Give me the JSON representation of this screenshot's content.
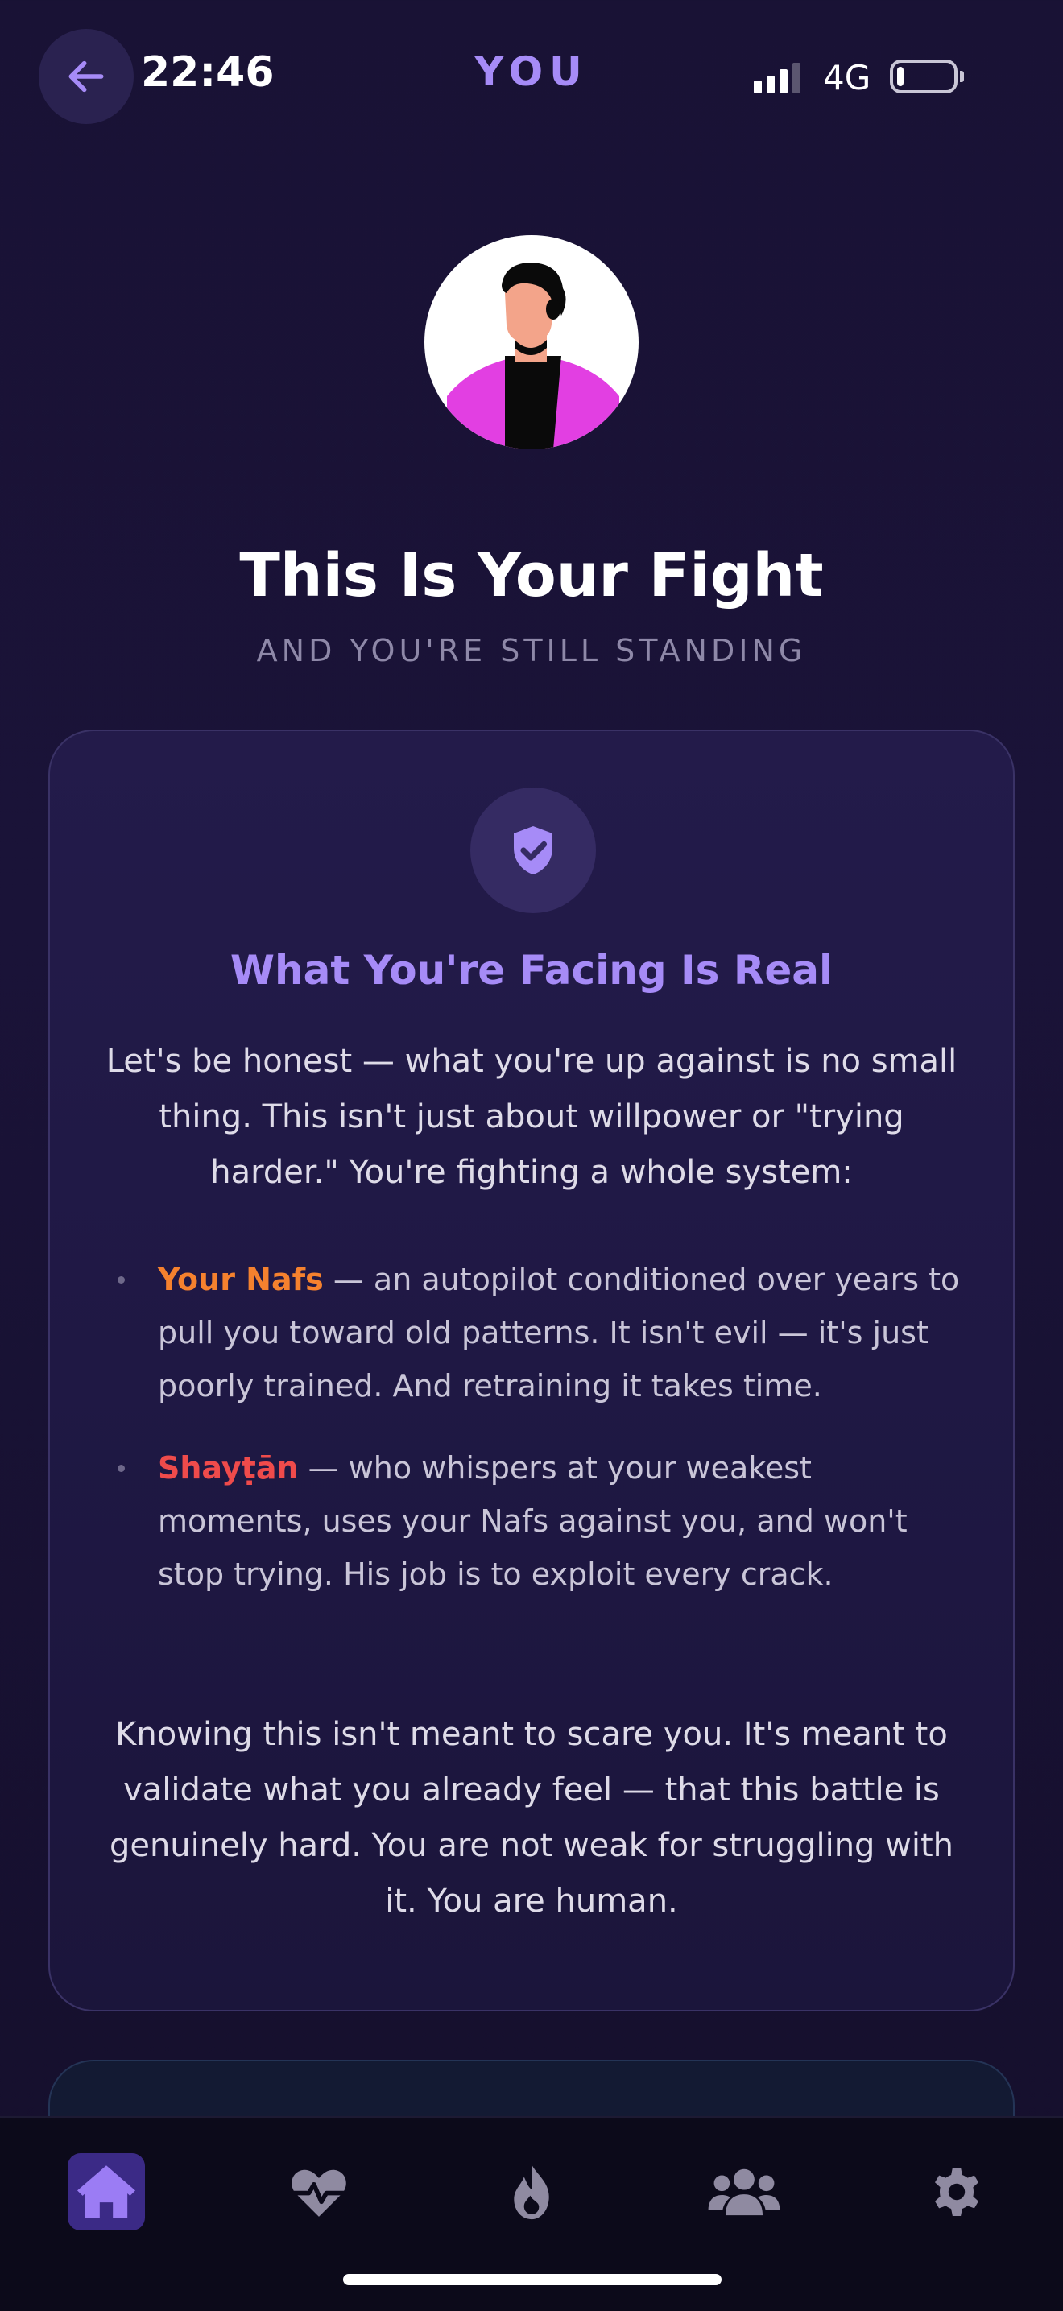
{
  "status_bar": {
    "time": "22:46",
    "network": "4G",
    "battery_level": 0.12
  },
  "header": {
    "back_icon": "arrow-left-icon",
    "title": "YOU"
  },
  "hero": {
    "avatar": "person-avatar",
    "title": "This Is Your Fight",
    "subtitle": "AND YOU'RE STILL STANDING"
  },
  "card": {
    "icon": "shield-check-icon",
    "title": "What You're Facing Is Real",
    "intro": "Let's be honest — what you're up against is no small thing. This isn't just about willpower or \"trying harder.\" You're fighting a whole system:",
    "bullets": [
      {
        "term": "Your Nafs",
        "text": " — an autopilot conditioned over years to pull you toward old patterns. It isn't evil — it's just poorly trained. And retraining it takes time."
      },
      {
        "term": "Shayṭān",
        "text": " — who whispers at your weakest moments, uses your Nafs against you, and won't stop trying. His job is to exploit every crack."
      }
    ],
    "closing": "Knowing this isn't meant to scare you. It's meant to validate what you already feel — that this battle is genuinely hard. You are not weak for struggling with it. You are human."
  },
  "tabbar": {
    "tabs": [
      {
        "name": "home",
        "icon": "home-icon",
        "active": true
      },
      {
        "name": "health",
        "icon": "heart-pulse-icon",
        "active": false
      },
      {
        "name": "streak",
        "icon": "flame-icon",
        "active": false
      },
      {
        "name": "community",
        "icon": "users-icon",
        "active": false
      },
      {
        "name": "settings",
        "icon": "gear-icon",
        "active": false
      }
    ]
  },
  "colors": {
    "accent": "#a68bf7",
    "background": "#191235",
    "nafs": "#f5812e",
    "shaytan": "#ef4b4b",
    "active_tab": "#3b2a86"
  }
}
